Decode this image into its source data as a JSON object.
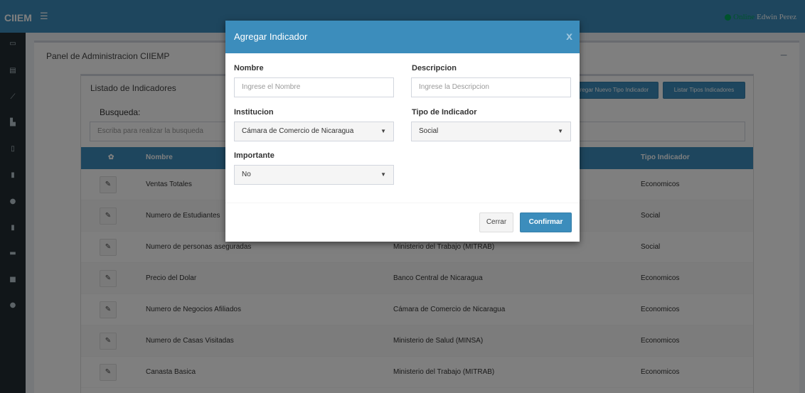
{
  "app": {
    "brand": "CIIEM",
    "hamburger_icon": "hamburger-menu-icon",
    "online_label": "Online",
    "user_name": "Edwin Perez"
  },
  "sidebar": {
    "items": [
      {
        "icon": "laptop-icon",
        "glyph": "▭"
      },
      {
        "icon": "list-icon",
        "glyph": "▤"
      },
      {
        "icon": "line-chart-icon",
        "glyph": "⟋"
      },
      {
        "icon": "bar-chart-icon",
        "glyph": "▙"
      },
      {
        "icon": "file-pdf-icon",
        "glyph": "▯"
      },
      {
        "icon": "building-icon",
        "glyph": "▮"
      },
      {
        "icon": "comments-icon",
        "glyph": "●"
      },
      {
        "icon": "file-icon",
        "glyph": "▮"
      },
      {
        "icon": "image-icon",
        "glyph": "▬"
      },
      {
        "icon": "plus-square-icon",
        "glyph": "■"
      },
      {
        "icon": "info-icon",
        "glyph": "●"
      }
    ]
  },
  "panel": {
    "title": "Panel de Administracion CIIEMP",
    "collapse_glyph": "−"
  },
  "listado": {
    "title": "Listado de Indicadores",
    "btn_new_type": "Agregar Nuevo Tipo Indicador",
    "btn_list_types": "Listar Tipos Indicadores",
    "search_label": "Busqueda:",
    "search_placeholder": "Escriba para realizar la busqueda"
  },
  "table": {
    "headers": {
      "gear": "✿",
      "nombre": "Nombre",
      "tipo": "Tipo Indicador"
    },
    "rows": [
      {
        "nombre": "Ventas Totales",
        "institucion": "",
        "tipo": "Economicos"
      },
      {
        "nombre": "Numero de Estudiantes",
        "institucion": "",
        "tipo": "Social"
      },
      {
        "nombre": "Numero de personas aseguradas",
        "institucion": "Ministerio del Trabajo (MITRAB)",
        "tipo": "Social"
      },
      {
        "nombre": "Precio del Dolar",
        "institucion": "Banco Central de Nicaragua",
        "tipo": "Economicos"
      },
      {
        "nombre": "Numero de Negocios Afiliados",
        "institucion": "Cámara de Comercio de Nicaragua",
        "tipo": "Economicos"
      },
      {
        "nombre": "Numero de Casas Visitadas",
        "institucion": "Ministerio de Salud (MINSA)",
        "tipo": "Economicos"
      },
      {
        "nombre": "Canasta Basica",
        "institucion": "Ministerio del Trabajo (MITRAB)",
        "tipo": "Economicos"
      }
    ],
    "edit_glyph": "✎"
  },
  "modal": {
    "title": "Agregar Indicador",
    "close_glyph": "x",
    "nombre_label": "Nombre",
    "nombre_placeholder": "Ingrese el Nombre",
    "descripcion_label": "Descripcion",
    "descripcion_placeholder": "Ingrese la Descripcion",
    "institucion_label": "Institucion",
    "institucion_value": "Cámara de Comercio de Nicaragua",
    "tipo_label": "Tipo de Indicador",
    "tipo_value": "Social",
    "importante_label": "Importante",
    "importante_value": "No",
    "caret_glyph": "▼",
    "btn_cerrar": "Cerrar",
    "btn_confirmar": "Confirmar"
  },
  "colors": {
    "primary": "#3c8dbc",
    "sidebar": "#222d32",
    "online": "#00a65a"
  }
}
